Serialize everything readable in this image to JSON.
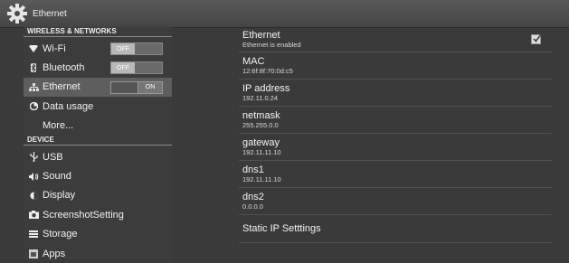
{
  "titlebar": {
    "title": "Ethernet",
    "icon": "gear-icon"
  },
  "sidebar": {
    "sections": [
      {
        "label": "WIRELESS & NETWORKS"
      },
      {
        "label": "DEVICE"
      }
    ],
    "items": [
      {
        "label": "Wi-Fi",
        "icon": "wifi-icon",
        "toggle": "OFF"
      },
      {
        "label": "Bluetooth",
        "icon": "bluetooth-icon",
        "toggle": "OFF"
      },
      {
        "label": "Ethernet",
        "icon": "ethernet-icon",
        "toggle": "ON"
      },
      {
        "label": "Data usage",
        "icon": "data-usage-icon"
      },
      {
        "label": "More..."
      },
      {
        "label": "USB",
        "icon": "usb-icon"
      },
      {
        "label": "Sound",
        "icon": "sound-icon"
      },
      {
        "label": "Display",
        "icon": "display-icon"
      },
      {
        "label": "ScreenshotSetting",
        "icon": "camera-icon"
      },
      {
        "label": "Storage",
        "icon": "storage-icon"
      },
      {
        "label": "Apps",
        "icon": "apps-icon"
      }
    ]
  },
  "detail": {
    "ethernet": {
      "title": "Ethernet",
      "summary": "Ethernet is enabled",
      "checked": true
    },
    "mac": {
      "title": "MAC",
      "value": "12:6f:8f:70:0d:c5"
    },
    "ip": {
      "title": "IP address",
      "value": "192.11.0.24"
    },
    "netmask": {
      "title": "netmask",
      "value": "255.255.0.0"
    },
    "gateway": {
      "title": "gateway",
      "value": "192.11.11.10"
    },
    "dns1": {
      "title": "dns1",
      "value": "192.11.11.10"
    },
    "dns2": {
      "title": "dns2",
      "value": "0.0.0.0"
    },
    "static_ip": {
      "title": "Static IP Setttings"
    }
  },
  "colors": {
    "background": "#3a3a3a",
    "active_row": "#5e5e5e",
    "divider": "#505050"
  }
}
